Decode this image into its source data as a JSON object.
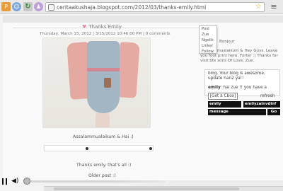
{
  "browser": {
    "url": "ceritaakushaja.blogspot.com/2012/03/thanks-emily.html"
  },
  "post": {
    "title": "Thanks Emily",
    "meta": "Thursday, March 15, 2012 | 3/15/2012 10:46:00 PM | 0 comments",
    "greeting": "Assalammualaikum & Hai :)",
    "closing": "Thanks emily. that's all :)",
    "older": "Older post :)"
  },
  "tagboard": {
    "title": "Bonjour",
    "welcome": "Assalammualaikum & Hey Guys. Leave you foot print here. Forter :) Thanks for visit bte sons Of Love, Zue.",
    "message1": "blog. Your blog is awesome, update han2 ya!!",
    "message2_name": "emily",
    "message2_text": ": hai zue !! you have a",
    "get_cbox": "[Get a Cbox]",
    "refresh": "refresh",
    "name_field": "emily",
    "url_field": "emilyzainvdinf",
    "message_field": "message",
    "go": "Go"
  },
  "dropdown": [
    "Post",
    "Zue",
    "Ngelik",
    "Linker",
    "Follow"
  ]
}
